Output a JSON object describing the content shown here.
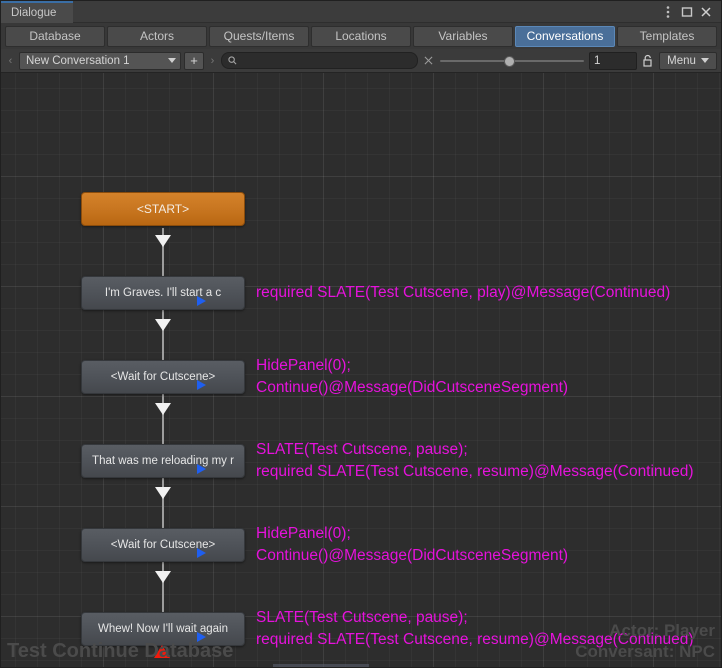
{
  "window": {
    "tab_title": "Dialogue",
    "controls": [
      {
        "name": "kebab-menu-icon",
        "glyph": "⋮"
      },
      {
        "name": "maximize-icon",
        "glyph": "□"
      },
      {
        "name": "close-icon",
        "glyph": "✕"
      }
    ]
  },
  "tabs": [
    {
      "label": "Database",
      "active": false
    },
    {
      "label": "Actors",
      "active": false
    },
    {
      "label": "Quests/Items",
      "active": false
    },
    {
      "label": "Locations",
      "active": false
    },
    {
      "label": "Variables",
      "active": false
    },
    {
      "label": "Conversations",
      "active": true
    },
    {
      "label": "Templates",
      "active": false
    }
  ],
  "toolbar": {
    "prev_arrow": "‹",
    "next_arrow": "›",
    "conversation_selected": "New Conversation 1",
    "add_button": "+",
    "search_value": "",
    "search_placeholder": "",
    "clear_search": "✕",
    "zoom_value": "1",
    "menu_label": "Menu",
    "menu_caret": "▾"
  },
  "canvas": {
    "nodes": [
      {
        "type": "start",
        "label": "<START>",
        "has_play": false
      },
      {
        "type": "dialogue",
        "label": "I'm Graves. I'll start a c",
        "has_play": true
      },
      {
        "type": "dialogue",
        "label": "<Wait for Cutscene>",
        "has_play": true
      },
      {
        "type": "dialogue",
        "label": "That was me reloading my r",
        "has_play": true
      },
      {
        "type": "dialogue",
        "label": "<Wait for Cutscene>",
        "has_play": true
      },
      {
        "type": "dialogue",
        "label": "Whew! Now I'll wait again",
        "has_play": true
      }
    ],
    "scripts": [
      {
        "lines": [
          "required SLATE(Test Cutscene, play)@Message(Continued)"
        ]
      },
      {
        "lines": [
          "HidePanel(0);",
          "Continue()@Message(DidCutsceneSegment)"
        ]
      },
      {
        "lines": [
          "SLATE(Test Cutscene, pause);",
          "required SLATE(Test Cutscene, resume)@Message(Continued)"
        ]
      },
      {
        "lines": [
          "HidePanel(0);",
          "Continue()@Message(DidCutsceneSegment)"
        ]
      },
      {
        "lines": [
          "SLATE(Test Cutscene, pause);",
          "required SLATE(Test Cutscene, resume)@Message(Continued)"
        ]
      }
    ],
    "overlay": {
      "database_name": "Test Continue Database",
      "actor": "Actor: Player",
      "conversant": "Conversant: NPC"
    }
  },
  "colors": {
    "accent_tab": "#4a6f99",
    "start_node": "#c87620",
    "dialogue_node": "#4e5258",
    "script_text": "#e612dc",
    "play_marker": "#1f5ff0",
    "red_marker": "#f21a0c",
    "canvas_bg": "#2d2d2d"
  }
}
